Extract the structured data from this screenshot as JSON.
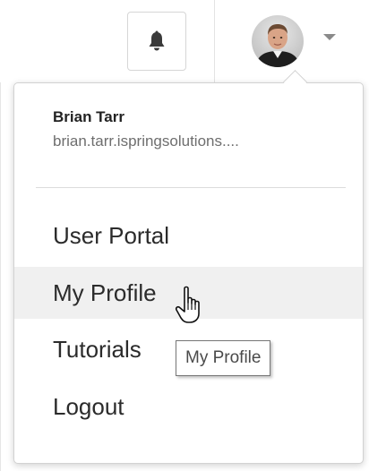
{
  "header": {
    "notifications_icon": "bell-icon",
    "avatar_icon": "user-avatar",
    "dropdown_icon": "caret-down-icon"
  },
  "menu": {
    "user_name": "Brian Tarr",
    "user_email": "brian.tarr.ispringsolutions....",
    "items": [
      {
        "label": "User Portal"
      },
      {
        "label": "My Profile"
      },
      {
        "label": "Tutorials"
      },
      {
        "label": "Logout"
      }
    ],
    "hovered_item": "My Profile"
  },
  "tooltip": {
    "text": "My Profile"
  },
  "colors": {
    "hover_bg": "#f0f0f0",
    "text": "#2b2b2b",
    "muted": "#6e6e6e",
    "border": "#d2d2d2"
  }
}
